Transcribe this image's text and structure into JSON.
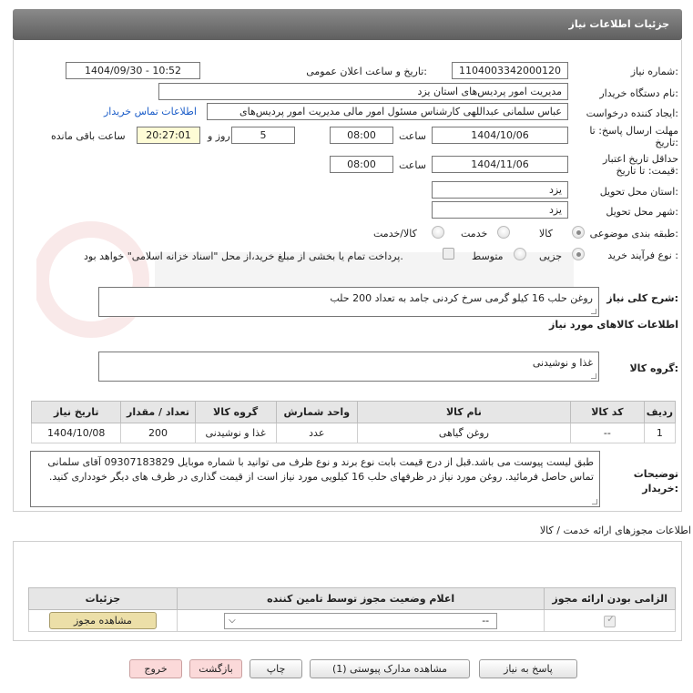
{
  "header": {
    "title": "جزئیات اطلاعات نیاز"
  },
  "form": {
    "need_number_label": "شماره نیاز:",
    "need_number": "1104003342000120",
    "announce_label": "تاریخ و ساعت اعلان عمومی:",
    "announce_value": "1404/09/30 - 10:52",
    "buyer_org_label": "نام دستگاه خریدار:",
    "buyer_org": "مدیریت امور پردیس‌های استان یزد",
    "creator_label": "ایجاد کننده درخواست:",
    "creator": "عباس سلمانی عبداللهی کارشناس مسئول امور مالی مدیریت امور پردیس‌های",
    "contact_link": "اطلاعات تماس خریدار",
    "deadline_label_1": "مهلت ارسال پاسخ: تا",
    "deadline_label_2": "تاریخ:",
    "deadline_date": "1404/10/06",
    "time_label": "ساعت",
    "deadline_time": "08:00",
    "days_value": "5",
    "days_label": "روز و",
    "remaining_time": "20:27:01",
    "remaining_label": "ساعت باقی مانده",
    "validity_label_1": "حداقل تاریخ اعتبار",
    "validity_label_2": "قیمت: تا تاریخ:",
    "validity_date": "1404/11/06",
    "validity_time": "08:00",
    "province_label": "استان محل تحویل:",
    "province": "یزد",
    "city_label": "شهر محل تحویل:",
    "city": "یزد",
    "category_label": "طبقه بندی موضوعی:",
    "category_options": [
      "کالا",
      "خدمت",
      "کالا/خدمت"
    ],
    "process_label": "نوع فرآیند خرید :",
    "process_options": [
      "جزیی",
      "متوسط"
    ],
    "payment_note": "پرداخت تمام یا بخشی از مبلغ خرید،از محل \"اسناد خزانه اسلامی\" خواهد بود."
  },
  "summary": {
    "label": "شرح کلی نیاز:",
    "text": "روغن حلب 16 کیلو گرمی سرخ کردنی جامد به تعداد 200 حلب"
  },
  "goods": {
    "section_title": "اطلاعات کالاهای مورد نیاز",
    "group_label": "گروه کالا:",
    "group_value": "غذا و نوشیدنی",
    "columns": [
      "ردیف",
      "کد کالا",
      "نام کالا",
      "واحد شمارش",
      "گروه کالا",
      "تعداد / مقدار",
      "تاریخ نیاز"
    ],
    "rows": [
      [
        "1",
        "--",
        "روغن گیاهی",
        "عدد",
        "غذا و نوشیدنی",
        "200",
        "1404/10/08"
      ]
    ]
  },
  "buyer_notes": {
    "label_1": "توضیحات",
    "label_2": "خریدار:",
    "text": "طبق لیست پیوست می باشد.قبل از درج قیمت بابت نوع برند و نوع ظرف می توانید با شماره موبایل 09307183829 آقای سلمانی تماس حاصل فرمائید. روغن مورد نیاز در ظرفهای حلب 16 کیلویی مورد نیاز است از قیمت گذاری در ظرف های دیگر خودداری کنید."
  },
  "permits": {
    "section_title": "اطلاعات مجوزهای ارائه خدمت / کالا",
    "columns": [
      "الزامی بودن ارائه مجوز",
      "اعلام وضعیت مجوز توسط تامین کننده",
      "جزئیات"
    ],
    "select_value": "--",
    "view_button": "مشاهده مجوز"
  },
  "buttons": {
    "reply": "پاسخ به نیاز",
    "attachments": "مشاهده مدارک پیوستی (1)",
    "print": "چاپ",
    "back": "بازگشت",
    "exit": "خروج"
  }
}
